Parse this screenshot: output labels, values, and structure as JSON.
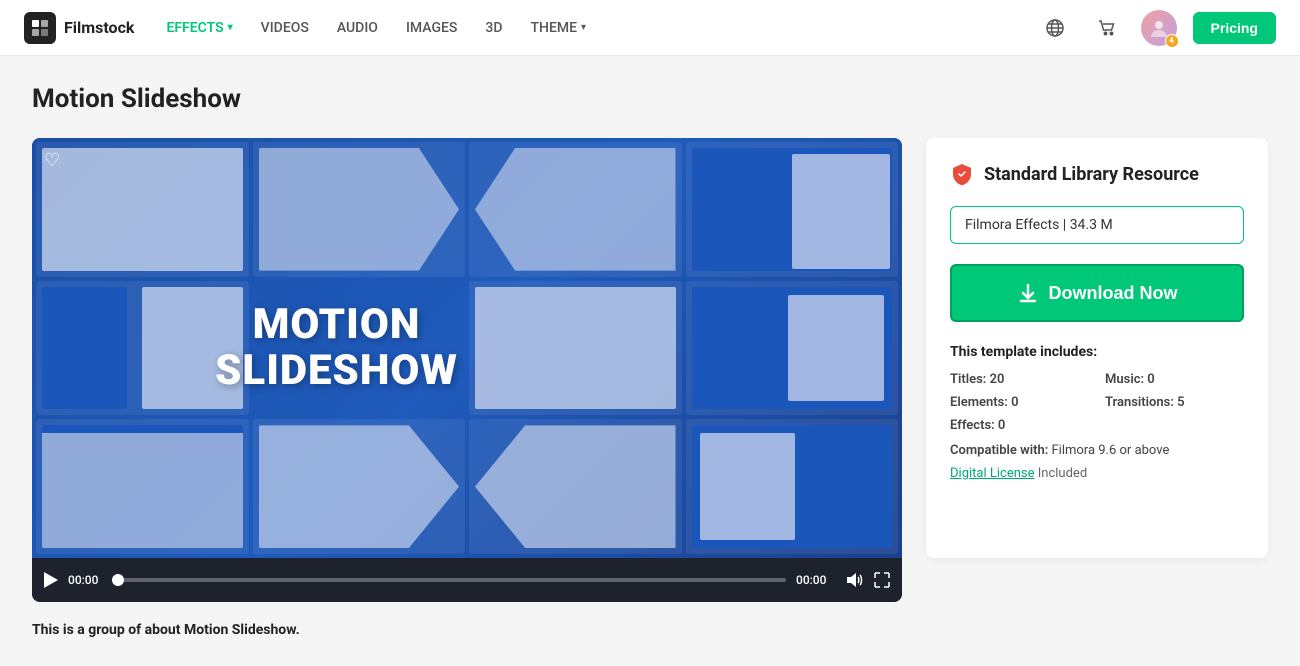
{
  "navbar": {
    "logo_text": "Filmstock",
    "logo_icon": "F",
    "nav_items": [
      {
        "label": "EFFECTS",
        "active": true,
        "has_dropdown": true
      },
      {
        "label": "VIDEOS",
        "active": false,
        "has_dropdown": false
      },
      {
        "label": "AUDIO",
        "active": false,
        "has_dropdown": false
      },
      {
        "label": "IMAGES",
        "active": false,
        "has_dropdown": false
      },
      {
        "label": "3D",
        "active": false,
        "has_dropdown": false
      },
      {
        "label": "THEME",
        "active": false,
        "has_dropdown": true
      }
    ],
    "pricing_label": "Pricing",
    "avatar_badge": "4"
  },
  "page": {
    "title": "Motion Slideshow",
    "description": "This is a group of about Motion Slideshow."
  },
  "video": {
    "center_line1": "MOTION",
    "center_line2": "SLIDESHOW",
    "time_start": "00:00",
    "time_end": "00:00"
  },
  "sidebar": {
    "resource_label": "Standard Library Resource",
    "file_info": "Filmora Effects | 34.3 M",
    "download_button": "Download Now",
    "template_includes_label": "This template includes:",
    "stats": {
      "titles_label": "Titles:",
      "titles_value": "20",
      "music_label": "Music:",
      "music_value": "0",
      "elements_label": "Elements:",
      "elements_value": "0",
      "transitions_label": "Transitions:",
      "transitions_value": "5",
      "effects_label": "Effects:",
      "effects_value": "0"
    },
    "compatible_label": "Compatible with:",
    "compatible_value": "Filmora 9.6 or above",
    "license_link_text": "Digital License",
    "license_suffix": " Included"
  }
}
